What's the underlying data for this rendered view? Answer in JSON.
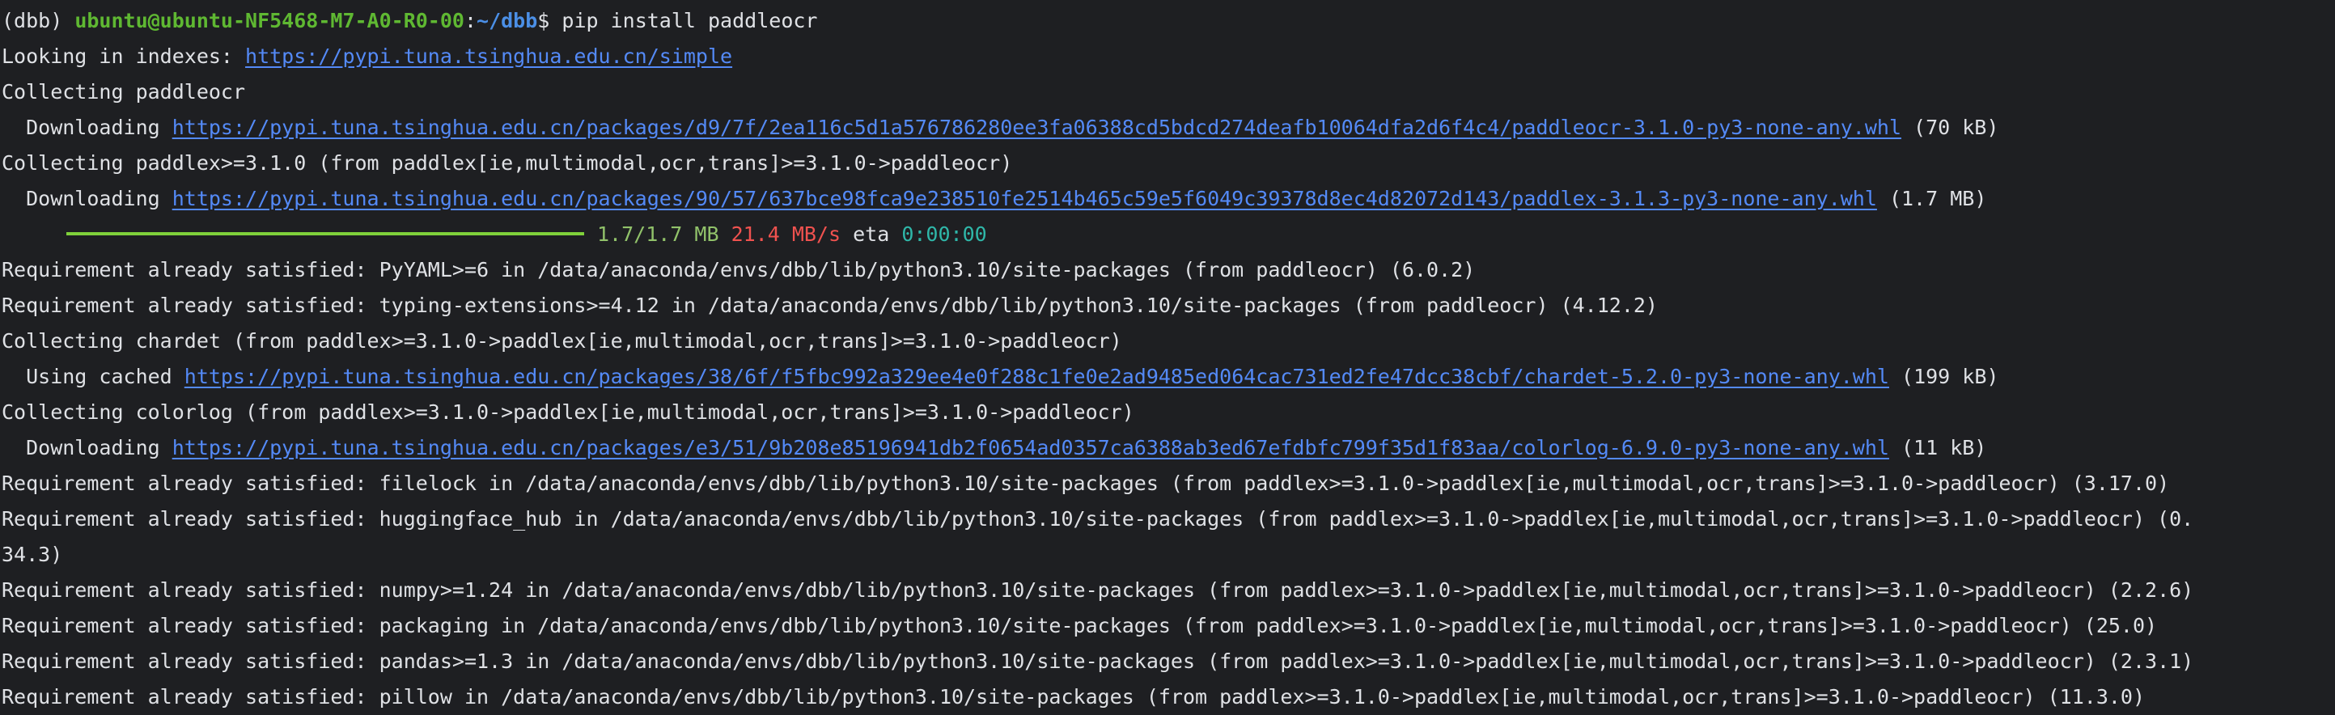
{
  "prompt": {
    "env": "(dbb) ",
    "user_host": "ubuntu@ubuntu-NF5468-M7-A0-R0-00",
    "sep": ":",
    "path": "~/dbb",
    "symbol": "$ ",
    "command": "pip install paddleocr"
  },
  "colors": {
    "background": "#1e1f22",
    "foreground": "#dfe1e5",
    "link": "#548af7",
    "prompt_user": "#5fb832",
    "prompt_path": "#4b8fe6",
    "progress_bar": "#7fd13b",
    "progress_speed": "#f0524f",
    "progress_eta": "#2fb7a9"
  },
  "progress": {
    "fraction": 1.0,
    "done": "1.7/1.7 MB",
    "speed": "21.4 MB/s",
    "eta_label": "eta ",
    "eta_value": "0:00:00"
  },
  "lines": [
    {
      "type": "prompt"
    },
    {
      "type": "text",
      "parts": [
        {
          "t": "Looking in indexes: "
        },
        {
          "t": "https://pypi.tuna.tsinghua.edu.cn/simple",
          "link": true
        }
      ]
    },
    {
      "type": "text",
      "parts": [
        {
          "t": "Collecting paddleocr"
        }
      ]
    },
    {
      "type": "text",
      "parts": [
        {
          "t": "  Downloading "
        },
        {
          "t": "https://pypi.tuna.tsinghua.edu.cn/packages/d9/7f/2ea116c5d1a576786280ee3fa06388cd5bdcd274deafb10064dfa2d6f4c4/paddleocr-3.1.0-py3-none-any.whl",
          "link": true
        },
        {
          "t": " (70 kB)"
        }
      ]
    },
    {
      "type": "text",
      "parts": [
        {
          "t": "Collecting paddlex>=3.1.0 (from paddlex[ie,multimodal,ocr,trans]>=3.1.0->paddleocr)"
        }
      ]
    },
    {
      "type": "text",
      "parts": [
        {
          "t": "  Downloading "
        },
        {
          "t": "https://pypi.tuna.tsinghua.edu.cn/packages/90/57/637bce98fca9e238510fe2514b465c59e5f6049c39378d8ec4d82072d143/paddlex-3.1.3-py3-none-any.whl",
          "link": true
        },
        {
          "t": " (1.7 MB)"
        }
      ]
    },
    {
      "type": "progress"
    },
    {
      "type": "text",
      "parts": [
        {
          "t": "Requirement already satisfied: PyYAML>=6 in /data/anaconda/envs/dbb/lib/python3.10/site-packages (from paddleocr) (6.0.2)"
        }
      ]
    },
    {
      "type": "text",
      "parts": [
        {
          "t": "Requirement already satisfied: typing-extensions>=4.12 in /data/anaconda/envs/dbb/lib/python3.10/site-packages (from paddleocr) (4.12.2)"
        }
      ]
    },
    {
      "type": "text",
      "parts": [
        {
          "t": "Collecting chardet (from paddlex>=3.1.0->paddlex[ie,multimodal,ocr,trans]>=3.1.0->paddleocr)"
        }
      ]
    },
    {
      "type": "text",
      "parts": [
        {
          "t": "  Using cached "
        },
        {
          "t": "https://pypi.tuna.tsinghua.edu.cn/packages/38/6f/f5fbc992a329ee4e0f288c1fe0e2ad9485ed064cac731ed2fe47dcc38cbf/chardet-5.2.0-py3-none-any.whl",
          "link": true
        },
        {
          "t": " (199 kB)"
        }
      ]
    },
    {
      "type": "text",
      "parts": [
        {
          "t": "Collecting colorlog (from paddlex>=3.1.0->paddlex[ie,multimodal,ocr,trans]>=3.1.0->paddleocr)"
        }
      ]
    },
    {
      "type": "text",
      "parts": [
        {
          "t": "  Downloading "
        },
        {
          "t": "https://pypi.tuna.tsinghua.edu.cn/packages/e3/51/9b208e85196941db2f0654ad0357ca6388ab3ed67efdbfc799f35d1f83aa/colorlog-6.9.0-py3-none-any.whl",
          "link": true
        },
        {
          "t": " (11 kB)"
        }
      ]
    },
    {
      "type": "text",
      "parts": [
        {
          "t": "Requirement already satisfied: filelock in /data/anaconda/envs/dbb/lib/python3.10/site-packages (from paddlex>=3.1.0->paddlex[ie,multimodal,ocr,trans]>=3.1.0->paddleocr) (3.17.0)"
        }
      ]
    },
    {
      "type": "text",
      "parts": [
        {
          "t": "Requirement already satisfied: huggingface_hub in /data/anaconda/envs/dbb/lib/python3.10/site-packages (from paddlex>=3.1.0->paddlex[ie,multimodal,ocr,trans]>=3.1.0->paddleocr) (0."
        }
      ]
    },
    {
      "type": "text",
      "parts": [
        {
          "t": "34.3)"
        }
      ]
    },
    {
      "type": "text",
      "parts": [
        {
          "t": "Requirement already satisfied: numpy>=1.24 in /data/anaconda/envs/dbb/lib/python3.10/site-packages (from paddlex>=3.1.0->paddlex[ie,multimodal,ocr,trans]>=3.1.0->paddleocr) (2.2.6)"
        }
      ]
    },
    {
      "type": "text",
      "parts": [
        {
          "t": "Requirement already satisfied: packaging in /data/anaconda/envs/dbb/lib/python3.10/site-packages (from paddlex>=3.1.0->paddlex[ie,multimodal,ocr,trans]>=3.1.0->paddleocr) (25.0)"
        }
      ]
    },
    {
      "type": "text",
      "parts": [
        {
          "t": "Requirement already satisfied: pandas>=1.3 in /data/anaconda/envs/dbb/lib/python3.10/site-packages (from paddlex>=3.1.0->paddlex[ie,multimodal,ocr,trans]>=3.1.0->paddleocr) (2.3.1)"
        }
      ]
    },
    {
      "type": "text",
      "parts": [
        {
          "t": "Requirement already satisfied: pillow in /data/anaconda/envs/dbb/lib/python3.10/site-packages (from paddlex>=3.1.0->paddlex[ie,multimodal,ocr,trans]>=3.1.0->paddleocr) (11.3.0)"
        }
      ]
    }
  ]
}
